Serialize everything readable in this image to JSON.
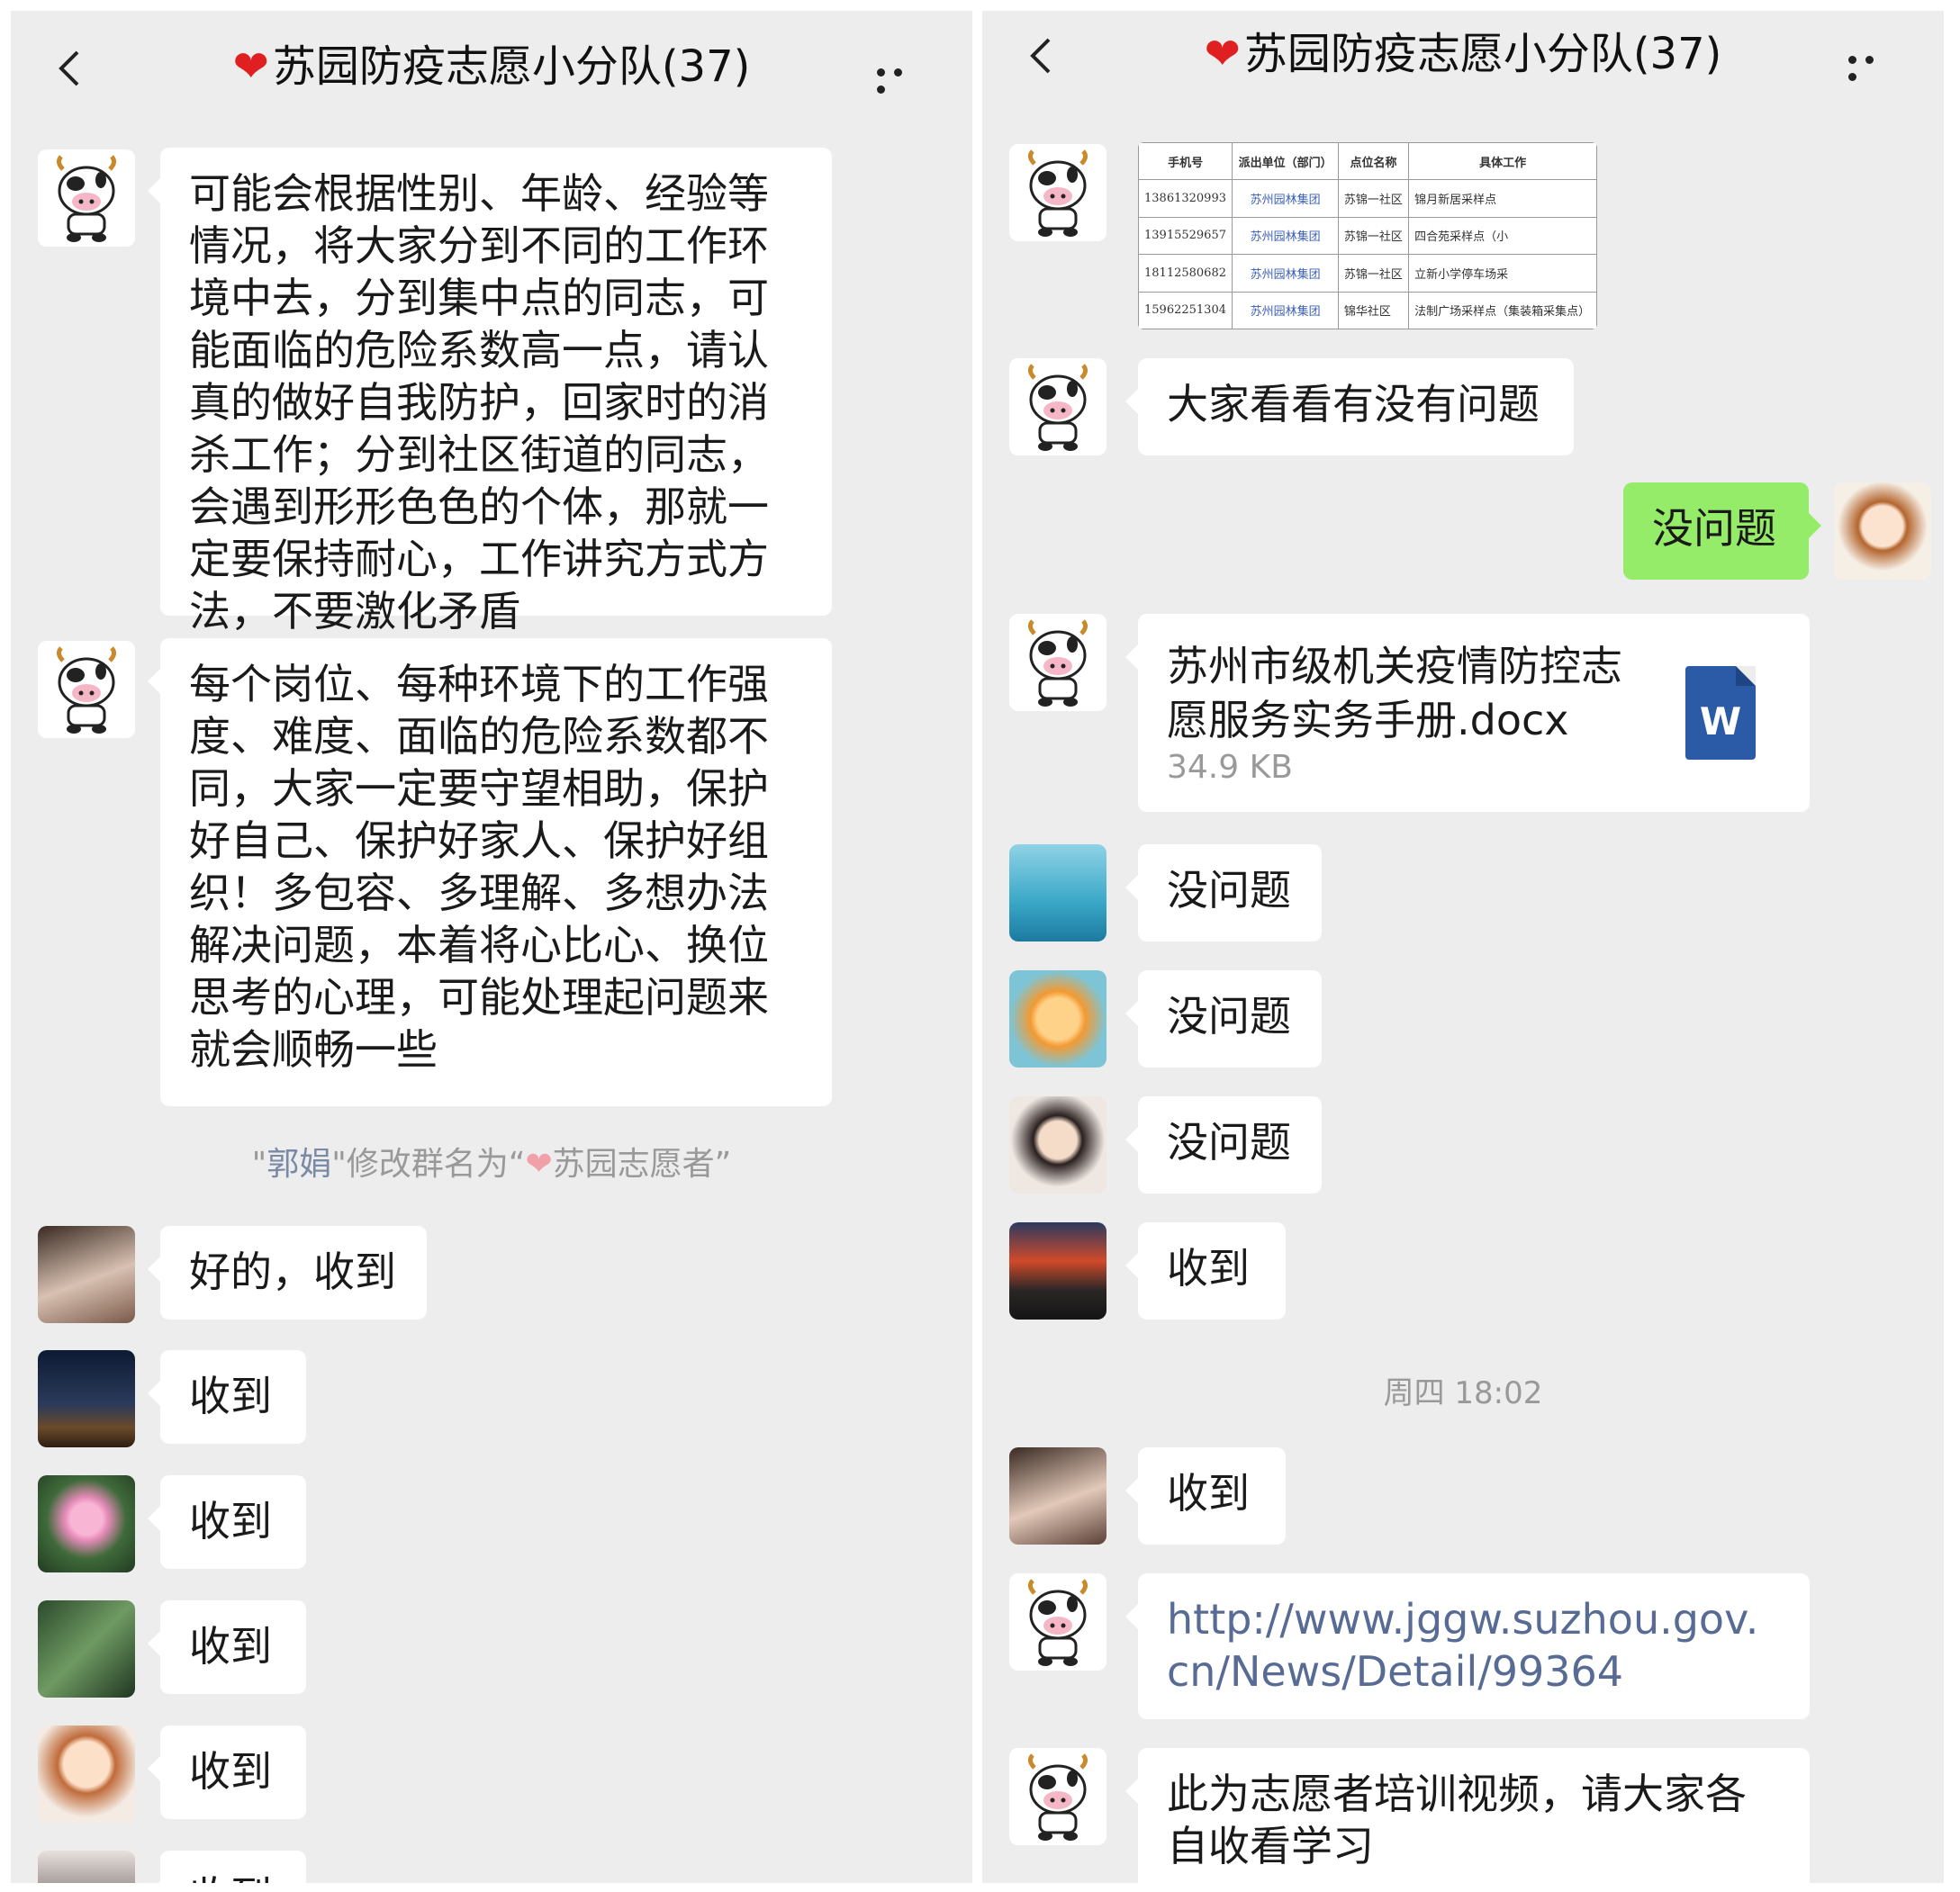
{
  "chat_title": "❤️苏园防疫志愿小分队(37)",
  "title_heart": "❤",
  "title_text": "苏园防疫志愿小分队(37)",
  "left": {
    "msg1": "可能会根据性别、年龄、经验等情况，将大家分到不同的工作环境中去，分到集中点的同志，可能面临的危险系数高一点，请认真的做好自我防护，回家时的消杀工作；分到社区街道的同志，会遇到形形色色的个体，那就一定要保持耐心，工作讲究方式方法，不要激化矛盾",
    "msg2": "每个岗位、每种环境下的工作强度、难度、面临的危险系数都不同，大家一定要守望相助，保护好自己、保护好家人、保护好组织！多包容、多理解、多想办法解决问题，本着将心比心、换位思考的心理，可能处理起问题来就会顺畅一些",
    "system_note": {
      "quote_open": "\"",
      "name": "郭娟",
      "action": "\"修改群名为“",
      "heart": "❤",
      "new_name": "苏园志愿者",
      "quote_close": "”"
    },
    "replies": [
      "好的，收到",
      "收到",
      "收到",
      "收到",
      "收到",
      "收到"
    ]
  },
  "right": {
    "table": {
      "headers": [
        "手机号",
        "派出单位（部门）",
        "点位名称",
        "具体工作"
      ],
      "rows": [
        [
          "13861320993",
          "苏州园林集团",
          "苏锦一社区",
          "锦月新居采样点"
        ],
        [
          "13915529657",
          "苏州园林集团",
          "苏锦一社区",
          "四合苑采样点（小"
        ],
        [
          "18112580682",
          "苏州园林集团",
          "苏锦一社区",
          "立新小学停车场采"
        ],
        [
          "15962251304",
          "苏州园林集团",
          "锦华社区",
          "法制广场采样点（集装箱采集点）"
        ]
      ]
    },
    "msg_check": "大家看看有没有问题",
    "my_reply": "没问题",
    "file": {
      "name": "苏州市级机关疫情防控志愿服务实务手册.docx",
      "size": "34.9 KB",
      "icon_letter": "W"
    },
    "replies": [
      "没问题",
      "没问题",
      "没问题",
      "收到"
    ],
    "timestamp": "周四 18:02",
    "reply_after_time": "收到",
    "link": "http://www.jggw.suzhou.gov.cn/News/Detail/99364",
    "video_note": "此为志愿者培训视频，请大家各自收看学习"
  },
  "colors": {
    "background": "#ededed",
    "bubble": "#ffffff",
    "my_bubble": "#95ec69",
    "link": "#576b95",
    "system_text": "#999999"
  },
  "icons": [
    "back-icon",
    "more-icon",
    "word-file-icon"
  ]
}
